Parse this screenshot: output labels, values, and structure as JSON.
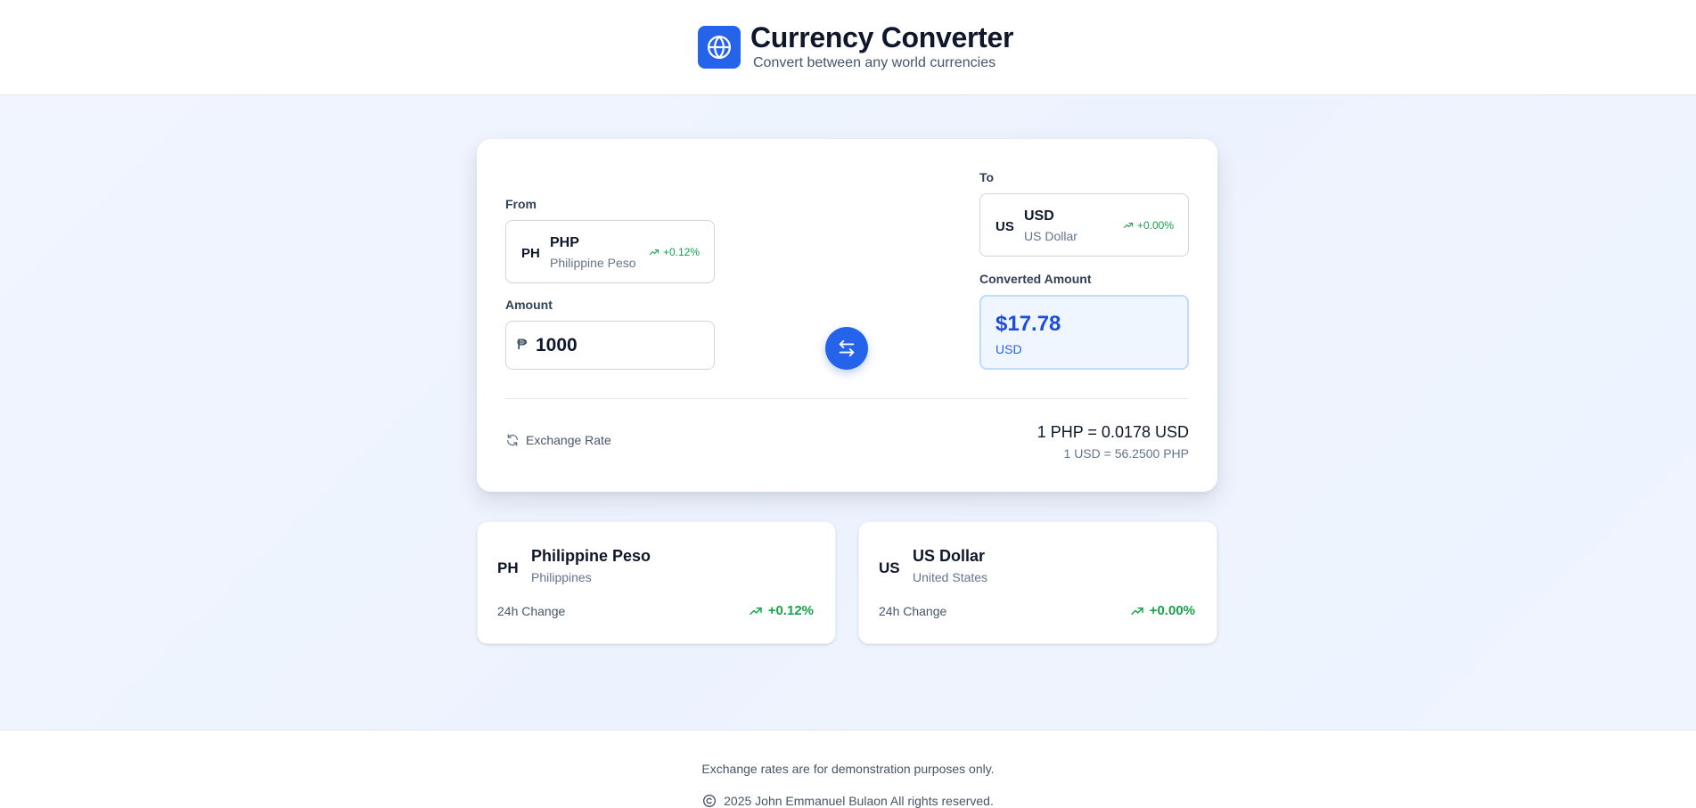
{
  "header": {
    "icon": "globe-icon",
    "title": "Currency Converter",
    "subtitle": "Convert between any world currencies"
  },
  "converter": {
    "from": {
      "label": "From",
      "flag": "PH",
      "code": "PHP",
      "name": "Philippine Peso",
      "change": "+0.12%"
    },
    "amount": {
      "label": "Amount",
      "symbol": "₱",
      "value": "1000"
    },
    "swap_icon": "swap-arrows-icon",
    "to": {
      "label": "To",
      "flag": "US",
      "code": "USD",
      "name": "US Dollar",
      "change": "+0.00%"
    },
    "converted": {
      "label": "Converted Amount",
      "value": "$17.78",
      "unit": "USD"
    },
    "rate": {
      "label": "Exchange Rate",
      "icon": "refresh-icon",
      "main": "1 PHP = 0.0178 USD",
      "inverse": "1 USD = 56.2500 PHP"
    }
  },
  "info_cards": [
    {
      "flag": "PH",
      "name": "Philippine Peso",
      "country": "Philippines",
      "change_label": "24h Change",
      "change": "+0.12%"
    },
    {
      "flag": "US",
      "name": "US Dollar",
      "country": "United States",
      "change_label": "24h Change",
      "change": "+0.00%"
    }
  ],
  "footer": {
    "disclaimer": "Exchange rates are for demonstration purposes only.",
    "copyright_icon": "copyright-icon",
    "copyright": "2025 John Emmanuel Bulaon All rights reserved."
  },
  "colors": {
    "accent": "#2563eb",
    "positive": "#16a34a",
    "background": "#eef3fe"
  }
}
